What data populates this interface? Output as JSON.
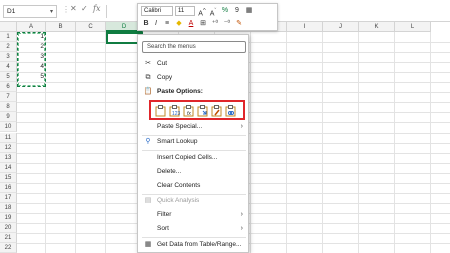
{
  "formula_bar": {
    "name_box": "D1",
    "fx_label": "fx",
    "formula_value": ""
  },
  "grid": {
    "columns": [
      "A",
      "B",
      "C",
      "D",
      "E",
      "F",
      "G",
      "H",
      "I",
      "J",
      "K",
      "L"
    ],
    "active_column": "D",
    "rows": [
      "1",
      "2",
      "3",
      "4",
      "5",
      "6",
      "7",
      "8",
      "9",
      "10",
      "11",
      "12",
      "13",
      "14",
      "15",
      "16",
      "17",
      "18",
      "19",
      "20",
      "21",
      "22"
    ],
    "cells_a": [
      "1",
      "2",
      "3",
      "4",
      "5"
    ]
  },
  "mini_toolbar": {
    "font_name": "Calibri",
    "font_size": "11",
    "bold": "B",
    "italic": "I",
    "font_color_icon": "A",
    "grow_font": "A^",
    "shrink_font": "Aˇ"
  },
  "context_menu": {
    "search_placeholder": "Search the menus",
    "items": {
      "cut": "Cut",
      "copy": "Copy",
      "paste_options": "Paste Options:",
      "paste_special": "Paste Special...",
      "smart_lookup": "Smart Lookup",
      "insert_copied_cells": "Insert Copied Cells...",
      "delete": "Delete...",
      "clear_contents": "Clear Contents",
      "quick_analysis": "Quick Analysis",
      "filter": "Filter",
      "sort": "Sort",
      "get_data": "Get Data from Table/Range..."
    }
  },
  "colors": {
    "accent_green": "#107c41",
    "highlight_red": "#e0262b"
  }
}
